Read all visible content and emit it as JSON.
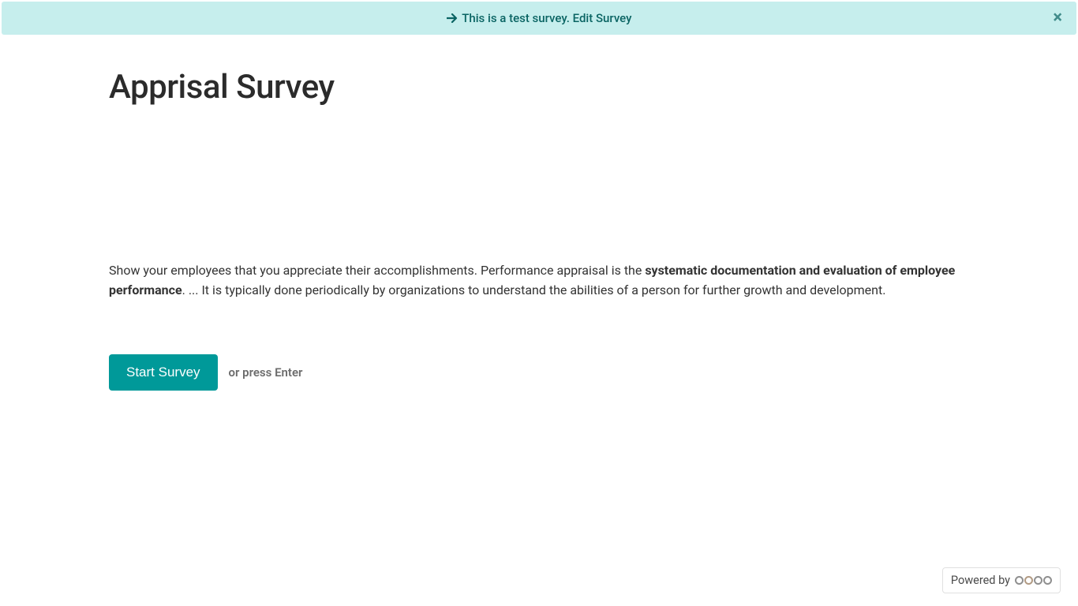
{
  "banner": {
    "notice": "This is a test survey. ",
    "edit_link": "Edit Survey"
  },
  "survey": {
    "title": "Apprisal Survey",
    "desc_part1": "Show your employees that you appreciate their accomplishments. Performance appraisal is the ",
    "desc_bold": "systematic documentation and evaluation of employee performance",
    "desc_part2": ". ... It is typically done periodically by organizations to understand the abilities of a person for further growth and development."
  },
  "actions": {
    "start_label": "Start Survey",
    "hint": "or press Enter"
  },
  "footer": {
    "powered_by": "Powered by"
  }
}
